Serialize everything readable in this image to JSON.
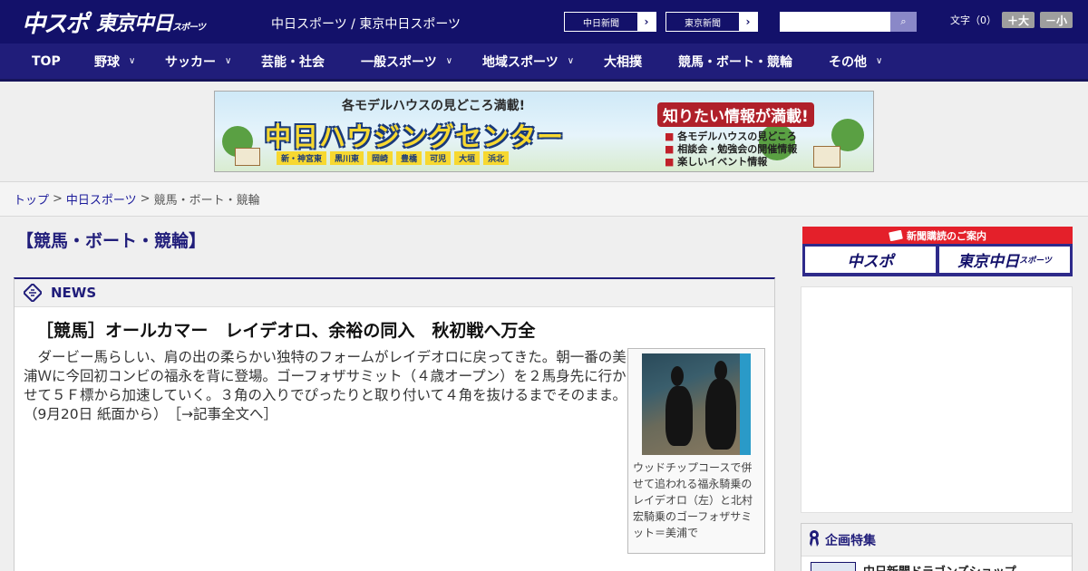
{
  "header": {
    "logo_chusupo": "中スポ",
    "logo_tokyo": "東京中日",
    "logo_tokyo_sub": "スポーツ",
    "caption": "中日スポーツ / 東京中日スポーツ",
    "paper_buttons": [
      {
        "label": "中日新聞",
        "arrow": "›"
      },
      {
        "label": "東京新聞",
        "arrow": "›"
      }
    ],
    "search": {
      "placeholder": "",
      "button_icon": "search-icon",
      "button_glyph": "⌕"
    },
    "font_size": {
      "label": "文字（0）",
      "larger": "＋大",
      "smaller": "－小"
    }
  },
  "nav": {
    "items": [
      {
        "label": "TOP",
        "has_menu": false
      },
      {
        "label": "野球",
        "has_menu": true
      },
      {
        "label": "サッカー",
        "has_menu": true
      },
      {
        "label": "芸能・社会",
        "has_menu": false
      },
      {
        "label": "一般スポーツ",
        "has_menu": true
      },
      {
        "label": "地域スポーツ",
        "has_menu": true
      },
      {
        "label": "大相撲",
        "has_menu": false
      },
      {
        "label": "競馬・ボート・競輪",
        "has_menu": false
      },
      {
        "label": "その他",
        "has_menu": true
      }
    ],
    "chevron": "∨"
  },
  "banner": {
    "top": "各モデルハウスの見どころ満載!",
    "main": "中日ハウジングセンター",
    "locations": [
      "新・神宮東",
      "黒川東",
      "岡崎",
      "豊橋",
      "可児",
      "大垣",
      "浜北"
    ],
    "right_head": "知りたい情報が満載!",
    "right_list": [
      "各モデルハウスの見どころ",
      "相談会・勉強会の開催情報",
      "楽しいイベント情報"
    ]
  },
  "breadcrumb": {
    "home": "トップ",
    "sep": " > ",
    "section": "中日スポーツ",
    "current": "競馬・ボート・競輪"
  },
  "main": {
    "title": "【競馬・ボート・競輪】",
    "news_label": "NEWS",
    "headline": "［競馬］オールカマー　レイデオロ、余裕の同入　秋初戦へ万全",
    "lead": "　ダービー馬らしい、肩の出の柔らかい独特のフォームがレイデオロに戻ってきた。朝一番の美浦Ｗに今回初コンビの福永を背に登場。ゴーフォザサミット（４歳オープン）を２馬身先に行かせて５Ｆ標から加速していく。３角の入りでぴったりと取り付いて４角を抜けるまでそのまま。（9月20日 紙面から）",
    "more_link": "［→記事全文へ］",
    "photo_caption": "ウッドチップコースで併せて追われる福永騎乗のレイデオロ（左）と北村宏騎乗のゴーフォザサミット＝美浦で"
  },
  "sidebar": {
    "subscribe_head": "新聞購読のご案内",
    "subscribe_chusupo": "中スポ",
    "subscribe_tokyo": "東京中日",
    "subscribe_tokyo_sub": "スポーツ",
    "feature_label": "企画特集",
    "feature_item": "中日新聞ドラゴンズショップ"
  }
}
